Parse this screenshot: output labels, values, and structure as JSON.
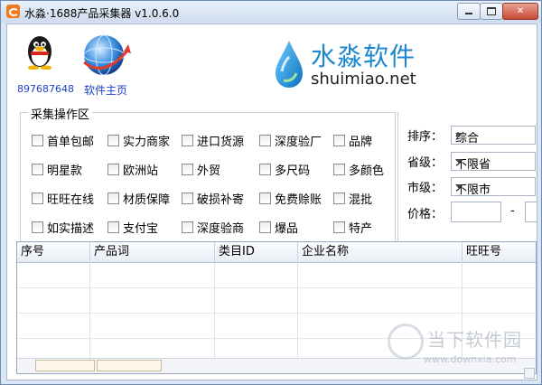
{
  "window": {
    "title": "水淼·1688产品采集器 v1.0.6.0",
    "controls": [
      "minimize",
      "maximize",
      "close"
    ]
  },
  "header": {
    "qq_number": "897687648",
    "home_link": "软件主页",
    "brand_name": "水淼软件",
    "brand_url": "shuimiao.net"
  },
  "filters": {
    "group_title": "采集操作区",
    "checkboxes": [
      [
        "首单包邮",
        "实力商家",
        "进口货源",
        "深度验厂",
        "品牌"
      ],
      [
        "明星款",
        "欧洲站",
        "外贸",
        "多尺码",
        "多颜色"
      ],
      [
        "旺旺在线",
        "材质保障",
        "破损补寄",
        "免费赊账",
        "混批"
      ],
      [
        "如实描述",
        "支付宝",
        "深度验商",
        "爆品",
        "特产"
      ]
    ]
  },
  "side": {
    "sort_label": "排序：",
    "sort_value": "综合",
    "province_label": "省级：",
    "province_value": "不限省",
    "city_label": "市级：",
    "city_value": "不限市",
    "price_label": "价格：",
    "price_sep": "-",
    "price_min": "",
    "price_max": ""
  },
  "grid": {
    "columns": [
      "序号",
      "产品词",
      "类目ID",
      "企业名称",
      "旺旺号"
    ]
  },
  "watermark": {
    "text": "当下软件园",
    "url": "www.downxia.com"
  },
  "colors": {
    "brand": "#1c87cf",
    "link": "#1d3fc9",
    "frame": "#dbe6f4"
  }
}
